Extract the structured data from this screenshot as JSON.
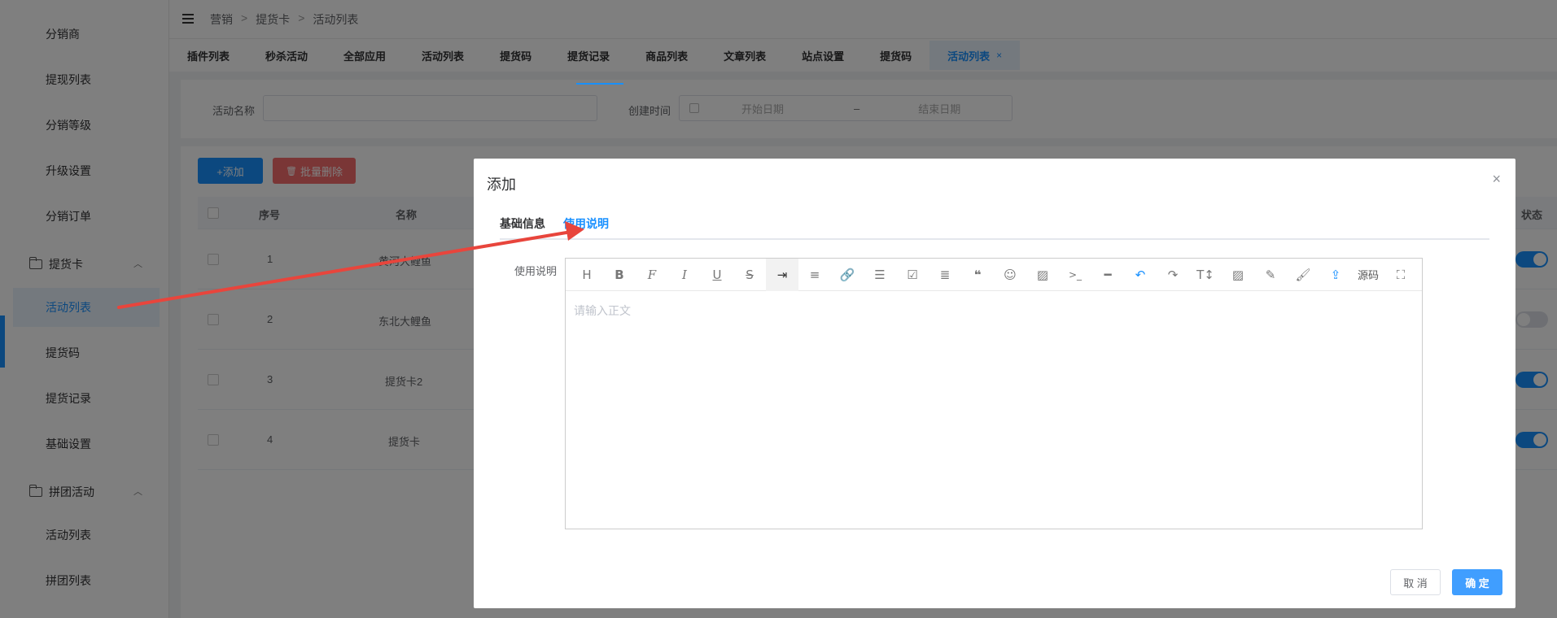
{
  "sidebar": {
    "items": [
      {
        "label": "分销商"
      },
      {
        "label": "提现列表"
      },
      {
        "label": "分销等级"
      },
      {
        "label": "升级设置"
      },
      {
        "label": "分销订单"
      }
    ],
    "group_pickup": {
      "label": "提货卡"
    },
    "pickup_items": [
      {
        "label": "活动列表"
      },
      {
        "label": "提货码"
      },
      {
        "label": "提货记录"
      },
      {
        "label": "基础设置"
      }
    ],
    "group_groupbuy": {
      "label": "拼团活动"
    },
    "groupbuy_items": [
      {
        "label": "活动列表"
      },
      {
        "label": "拼团列表"
      }
    ]
  },
  "breadcrumb": [
    "营销",
    "提货卡",
    "活动列表"
  ],
  "breadcrumb_sep": ">",
  "tabs": [
    {
      "label": "插件列表"
    },
    {
      "label": "秒杀活动"
    },
    {
      "label": "全部应用"
    },
    {
      "label": "活动列表"
    },
    {
      "label": "提货码"
    },
    {
      "label": "提货记录"
    },
    {
      "label": "商品列表"
    },
    {
      "label": "文章列表"
    },
    {
      "label": "站点设置"
    },
    {
      "label": "提货码"
    },
    {
      "label": "活动列表",
      "close": "×"
    }
  ],
  "filter": {
    "name_label": "活动名称",
    "name_value": "",
    "time_label": "创建时间",
    "start_placeholder": "开始日期",
    "range_sep": "–",
    "end_placeholder": "结束日期"
  },
  "actions": {
    "add_label": "+添加",
    "batch_delete_label": "批量删除"
  },
  "table": {
    "headers": {
      "index": "序号",
      "name": "名称",
      "status": "状态"
    },
    "rows": [
      {
        "index": "1",
        "name": "黄河大鲤鱼",
        "status_on": true
      },
      {
        "index": "2",
        "name": "东北大鲤鱼",
        "status_on": false
      },
      {
        "index": "3",
        "name": "提货卡2",
        "status_on": true
      },
      {
        "index": "4",
        "name": "提货卡",
        "status_on": true
      }
    ]
  },
  "dialog": {
    "title": "添加",
    "close": "×",
    "tabs": [
      {
        "label": "基础信息"
      },
      {
        "label": "使用说明"
      }
    ],
    "field_label": "使用说明",
    "editor_placeholder": "请输入正文",
    "toolbar": [
      "H",
      "B",
      "F",
      "I",
      "U",
      "S",
      "indent",
      "align",
      "link",
      "list",
      "todo",
      "justify",
      "quote",
      "emoji",
      "image",
      "code",
      "hr",
      "undo",
      "redo",
      "font-size",
      "image2",
      "eraser",
      "brush",
      "upload",
      "源码",
      "fullscreen"
    ],
    "source_label": "源码",
    "cancel_label": "取 消",
    "ok_label": "确 定"
  },
  "colors": {
    "primary": "#1890ff",
    "annotation_arrow": "#e8453c"
  }
}
